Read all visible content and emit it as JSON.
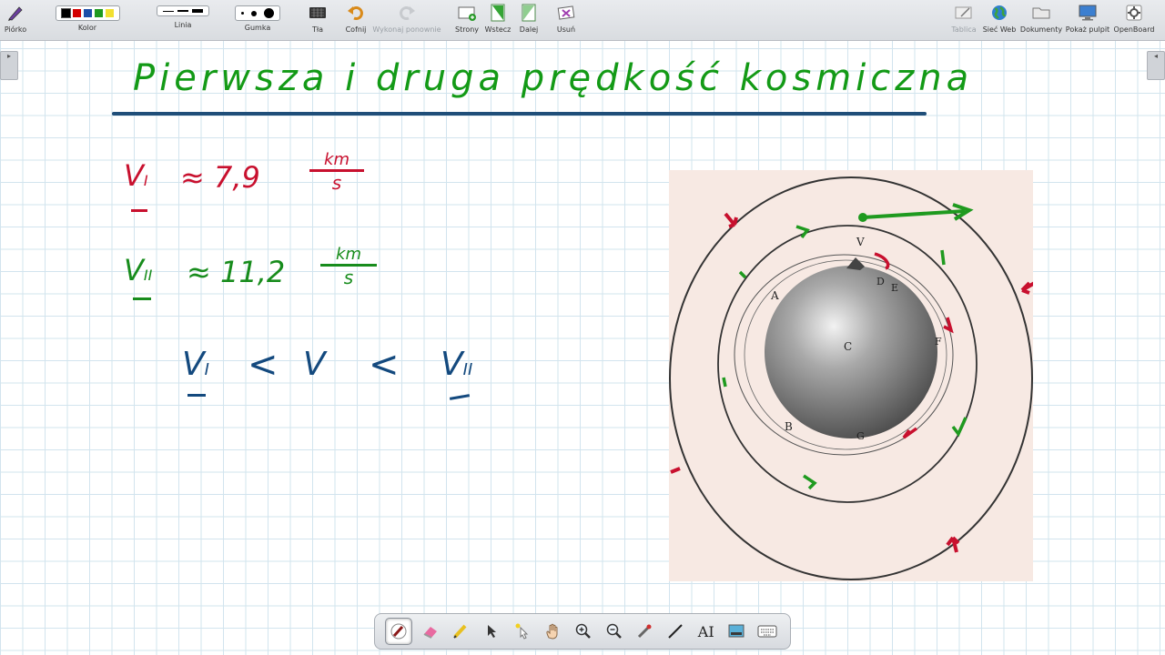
{
  "toolbar": {
    "pen_label": "Piórko",
    "color_label": "Kolor",
    "line_label": "Linia",
    "eraser_label": "Gumka",
    "background_label": "Tła",
    "undo_label": "Cofnij",
    "redo_label": "Wykonaj ponownie",
    "pages_label": "Strony",
    "back_label": "Wstecz",
    "next_label": "Dalej",
    "delete_label": "Usuń",
    "board_label": "Tablica",
    "web_label": "Sieć Web",
    "documents_label": "Dokumenty",
    "desktop_label": "Pokaż pulpit",
    "app_label": "OpenBoard",
    "colors": [
      "#000000",
      "#d40000",
      "#1c4fa8",
      "#1f9a1f",
      "#f2e030"
    ]
  },
  "board": {
    "title": "Pierwsza i druga prędkość kosmiczna",
    "v1_symbol": "V",
    "v1_sub": "I",
    "v1_value": "≈ 7,9",
    "v2_symbol": "V",
    "v2_sub": "II",
    "v2_value": "≈ 11,2",
    "unit_num": "km",
    "unit_den": "s",
    "ineq_left": "V",
    "ineq_left_sub": "I",
    "ineq_lt1": "<",
    "ineq_mid": "V",
    "ineq_lt2": "<",
    "ineq_right": "V",
    "ineq_right_sub": "II"
  },
  "figure": {
    "labels": [
      "V",
      "D",
      "E",
      "A",
      "C",
      "B",
      "G",
      "F"
    ]
  },
  "dock": {
    "tools": [
      "pen-icon",
      "eraser-icon",
      "marker-icon",
      "pointer-icon",
      "laser-icon",
      "hand-icon",
      "zoom-in-icon",
      "zoom-out-icon",
      "pointer-stick-icon",
      "line-icon",
      "text-icon",
      "capture-icon",
      "keyboard-icon"
    ]
  }
}
